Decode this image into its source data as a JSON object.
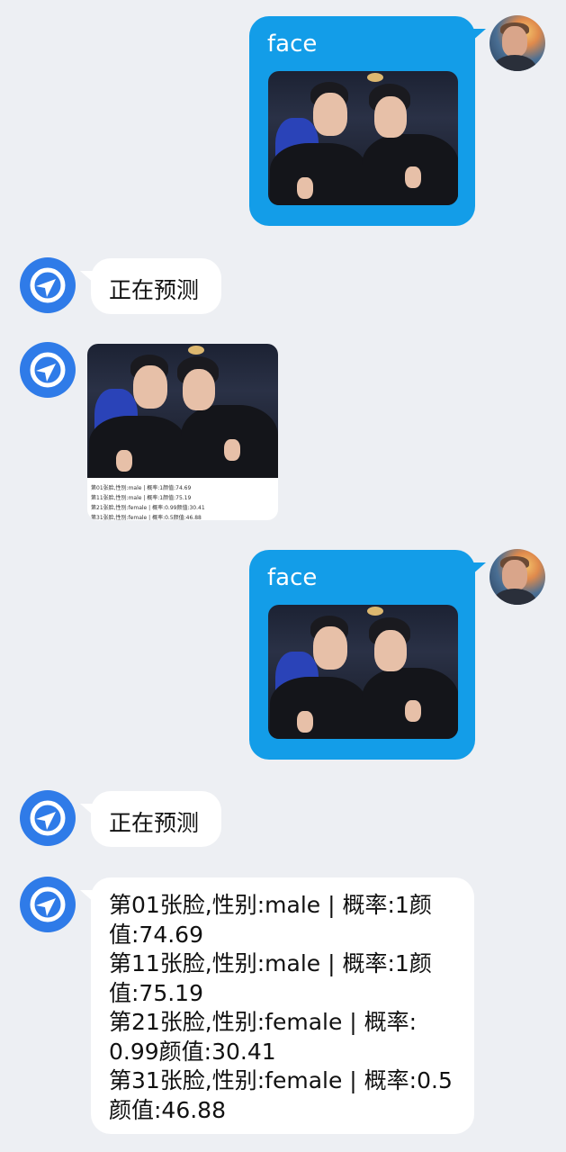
{
  "messages": {
    "user1": {
      "title": "face"
    },
    "bot1": {
      "status": "正在预测"
    },
    "bot2": {
      "caption_lines": [
        "第01张脸,性别:male | 概率:1颜值:74.69",
        "第11张脸,性别:male | 概率:1颜值:75.19",
        "第21张脸,性别:female | 概率:0.99颜值:30.41",
        "第31张脸,性别:female | 概率:0.5颜值:46.88"
      ]
    },
    "user2": {
      "title": "face"
    },
    "bot3": {
      "status": "正在预测"
    },
    "bot4": {
      "lines": [
        "第01张脸,性别:male | 概率:1颜",
        "值:74.69",
        "第11张脸,性别:male | 概率:1颜",
        "值:75.19",
        "第21张脸,性别:female | 概率:",
        "0.99颜值:30.41",
        "第31张脸,性别:female | 概率:0.5",
        "颜值:46.88"
      ]
    }
  },
  "colors": {
    "background": "#edeff3",
    "user_bubble": "#139de8",
    "bot_bubble": "#ffffff",
    "bot_avatar": "#2f7be8"
  },
  "icons": {
    "user_avatar": "user-photo-avatar",
    "bot_avatar": "bot-logo-icon"
  }
}
